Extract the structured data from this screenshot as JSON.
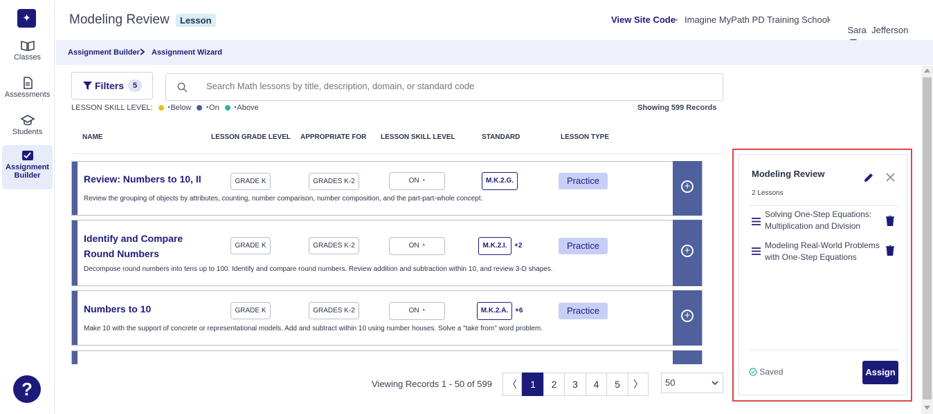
{
  "nav": {
    "items": [
      {
        "label": "Classes"
      },
      {
        "label": "Assessments"
      },
      {
        "label": "Students"
      },
      {
        "label": "Assignment Builder"
      }
    ],
    "help": "?"
  },
  "header": {
    "title": "Modeling Review",
    "badge": "Lesson",
    "view_site_code": "View Site Code",
    "school": "Imagine MyPath PD Training School",
    "user": "Sara  Jefferson"
  },
  "breadcrumb": [
    "Assignment Builder",
    "Assignment Wizard"
  ],
  "filters": {
    "label": "Filters",
    "count": "5"
  },
  "search": {
    "placeholder": "Search Math lessons by title, description, domain, or standard code"
  },
  "skill_legend": {
    "label": "LESSON SKILL LEVEL:",
    "below": "Below",
    "on": "On",
    "above": "Above"
  },
  "showing": "Showing 599 Records",
  "table": {
    "headers": [
      "NAME",
      "LESSON GRADE LEVEL",
      "APPROPRIATE FOR",
      "LESSON SKILL LEVEL",
      "STANDARD",
      "LESSON TYPE"
    ],
    "rows": [
      {
        "title": "Review: Numbers to 10, II",
        "desc": "Review the grouping of objects by attributes, counting, number comparison, number composition, and the part-part-whole concept.",
        "grade": "GRADE K",
        "appropriate": "GRADES K-2",
        "skill": "ON",
        "standard": "M.K.2.G.",
        "more": "",
        "type": "Practice"
      },
      {
        "title": "Identify and Compare Round Numbers",
        "desc": "Decompose round numbers into tens up to 100. Identify and compare round numbers. Review addition and subtraction within 10, and review 3-D shapes.",
        "grade": "GRADE K",
        "appropriate": "GRADES K-2",
        "skill": "ON",
        "standard": "M.K.2.I.",
        "more": "+2",
        "type": "Practice"
      },
      {
        "title": "Numbers to 10",
        "desc": "Make 10 with the support of concrete or representational models. Add and subtract within 10 using number houses. Solve a \"take from\" word problem.",
        "grade": "GRADE K",
        "appropriate": "GRADES K-2",
        "skill": "ON",
        "standard": "M.K.2.A.",
        "more": "+6",
        "type": "Practice"
      }
    ]
  },
  "pager": {
    "viewing": "Viewing Records 1 - 50 of 599",
    "prev": "〈",
    "next": "〉",
    "pages": [
      "1",
      "2",
      "3",
      "4",
      "5"
    ],
    "per_page": "50"
  },
  "panel": {
    "title": "Modeling Review",
    "count": "2 Lessons",
    "items": [
      "Solving One-Step Equations: Multiplication and Division",
      "Modeling Real-World Problems with One-Step Equations"
    ],
    "saved": "Saved",
    "assign": "Assign"
  },
  "colors": {
    "brand": "#1c1b7a",
    "stripe": "#50609c",
    "highlight": "#e04545"
  }
}
